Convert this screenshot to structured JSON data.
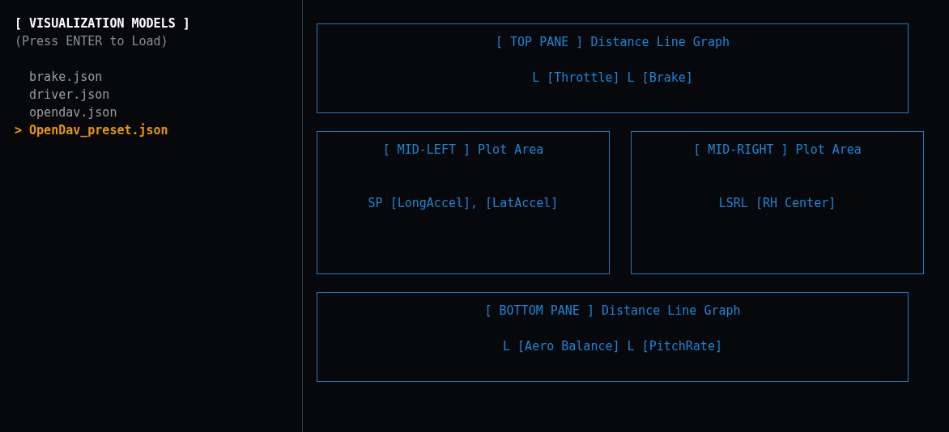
{
  "sidebar": {
    "title": "[ VISUALIZATION MODELS ]",
    "hint": "(Press ENTER to Load)",
    "cursor": ">",
    "items": [
      {
        "label": "brake.json",
        "selected": false
      },
      {
        "label": "driver.json",
        "selected": false
      },
      {
        "label": "opendav.json",
        "selected": false
      },
      {
        "label": "OpenDav_preset.json",
        "selected": true
      }
    ]
  },
  "rows": [
    {
      "kind": "short",
      "panes": [
        {
          "title": "[ TOP PANE ] Distance Line Graph",
          "content": "L [Throttle] L [Brake]"
        }
      ]
    },
    {
      "kind": "tall",
      "panes": [
        {
          "title": "[ MID-LEFT ] Plot Area",
          "content": "SP [LongAccel], [LatAccel]"
        },
        {
          "title": "[ MID-RIGHT ] Plot Area",
          "content": "LSRL [RH Center]"
        }
      ]
    },
    {
      "kind": "short",
      "panes": [
        {
          "title": "[ BOTTOM PANE ] Distance Line Graph",
          "content": "L [Aero Balance] L [PitchRate]"
        }
      ]
    }
  ]
}
